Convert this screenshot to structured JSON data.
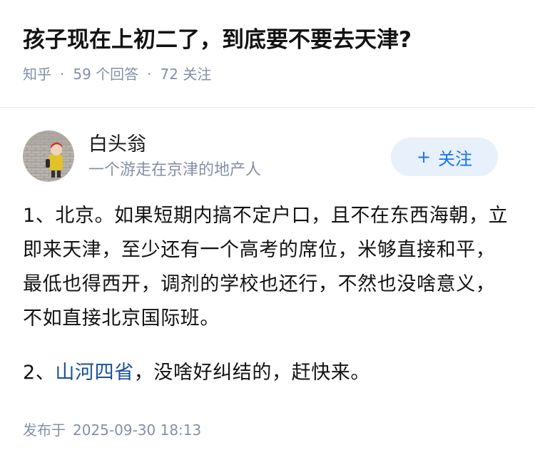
{
  "question": {
    "title": "孩子现在上初二了，到底要不要去天津?",
    "source": "知乎",
    "answers": "59 个回答",
    "followers": "72 关注"
  },
  "author": {
    "name": "白头翁",
    "bio": "一个游走在京津的地产人",
    "follow_label": "关注",
    "follow_icon": "plus-icon"
  },
  "answer": {
    "para1": "1、北京。如果短期内搞不定户口，且不在东西海朝，立即来天津，至少还有一个高考的席位，米够直接和平，最低也得西开，调剂的学校也还行，不然也没啥意义，不如直接北京国际班。",
    "para2_prefix": "2、",
    "para2_link": "山河四省",
    "para2_rest": "，没啥好纠结的，赶快来。"
  },
  "footer": {
    "publish_label": "发布于",
    "publish_time": "2025-09-30 18:13"
  },
  "colors": {
    "link": "#175199",
    "follow_text": "#1772f6",
    "follow_bg": "#e8f0fb",
    "meta": "#8590a6"
  }
}
